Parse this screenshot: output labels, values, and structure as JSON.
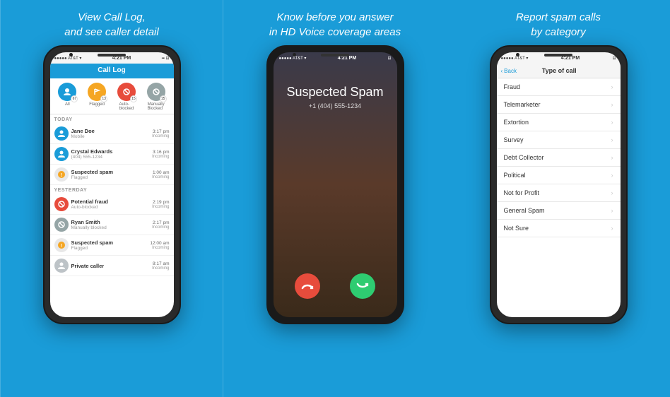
{
  "sections": [
    {
      "id": "section1",
      "caption_line1": "View Call Log,",
      "caption_line2": "and see caller detail",
      "phone": {
        "status_bar": {
          "signal": "●●●●● AT&T ▾",
          "time": "4:21 PM",
          "battery": "⊟"
        },
        "header_title": "Call Log",
        "tabs": [
          {
            "label": "All",
            "number": "67",
            "color": "blue",
            "icon": "person"
          },
          {
            "label": "Flagged",
            "number": "13",
            "color": "orange",
            "icon": "flag"
          },
          {
            "label": "Auto-blocked",
            "number": "15",
            "color": "red",
            "icon": "block"
          },
          {
            "label": "Manually Blocked",
            "number": "15",
            "color": "gray",
            "icon": "block2"
          }
        ],
        "sections": [
          {
            "label": "TODAY",
            "calls": [
              {
                "name": "Jane Doe",
                "sub": "Mobile",
                "time": "3:17 pm",
                "dir": "Incoming",
                "type": "contact"
              },
              {
                "name": "Crystal Edwards",
                "sub": "(404) 555-1234",
                "time": "3:16 pm",
                "dir": "Incoming",
                "type": "contact"
              },
              {
                "name": "Suspected spam",
                "sub": "Flagged",
                "time": "1:00 am",
                "dir": "Incoming",
                "type": "spam"
              }
            ]
          },
          {
            "label": "YESTERDAY",
            "calls": [
              {
                "name": "Potential fraud",
                "sub": "Auto-blocked",
                "time": "2:19 pm",
                "dir": "Incoming",
                "type": "fraud"
              },
              {
                "name": "Ryan Smith",
                "sub": "Manually blocked",
                "time": "2:17 pm",
                "dir": "Incoming",
                "type": "contact"
              },
              {
                "name": "Suspected spam",
                "sub": "Flagged",
                "time": "12:00 am",
                "dir": "Incoming",
                "type": "spam"
              },
              {
                "name": "Private caller",
                "sub": "",
                "time": "8:17 am",
                "dir": "Incoming",
                "type": "private"
              }
            ]
          }
        ]
      }
    },
    {
      "id": "section2",
      "caption_line1": "Know before you answer",
      "caption_line2": "in HD Voice coverage areas",
      "phone": {
        "status_bar": {
          "signal": "●●●●● AT&T ▾",
          "time": "4:21 PM",
          "battery": "⊟"
        },
        "caller_name": "Suspected Spam",
        "caller_number": "+1 (404) 555-1234"
      }
    },
    {
      "id": "section3",
      "caption_line1": "Report spam calls",
      "caption_line2": "by category",
      "phone": {
        "status_bar": {
          "signal": "●●●●● AT&T ▾",
          "time": "4:21 PM",
          "battery": "⊟"
        },
        "back_label": "Back",
        "header_title": "Type of call",
        "categories": [
          "Fraud",
          "Telemarketer",
          "Extortion",
          "Survey",
          "Debt Collector",
          "Political",
          "Not for Profit",
          "General Spam",
          "Not Sure"
        ]
      }
    }
  ]
}
